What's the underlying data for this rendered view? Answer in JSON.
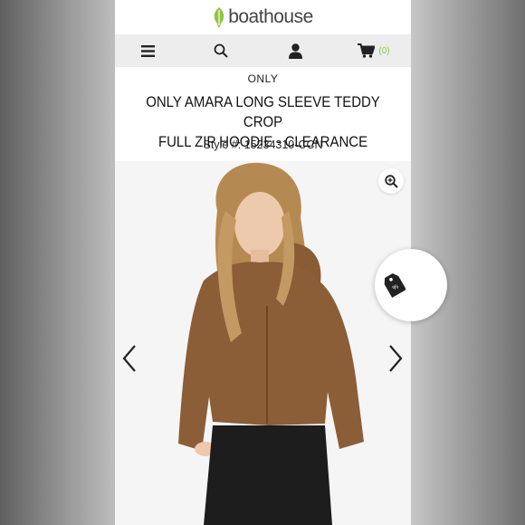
{
  "header": {
    "logo_text": "boathouse",
    "brand_color": "#8dc63f"
  },
  "nav": {
    "menu_icon": "menu-icon",
    "search_icon": "search-icon",
    "account_icon": "user-icon",
    "cart_icon": "cart-icon",
    "cart_count": "(0)"
  },
  "product": {
    "brand": "ONLY",
    "title_line1": "ONLY AMARA LONG SLEEVE TEDDY CROP",
    "title_line2": "FULL ZIP HOODIE - CLEARANCE",
    "style": "Style #: 15234310-CCN"
  },
  "gallery": {
    "zoom_icon": "zoom-in-icon",
    "tag_icon": "price-tag-icon",
    "prev_icon": "chevron-left-icon",
    "next_icon": "chevron-right-icon"
  }
}
